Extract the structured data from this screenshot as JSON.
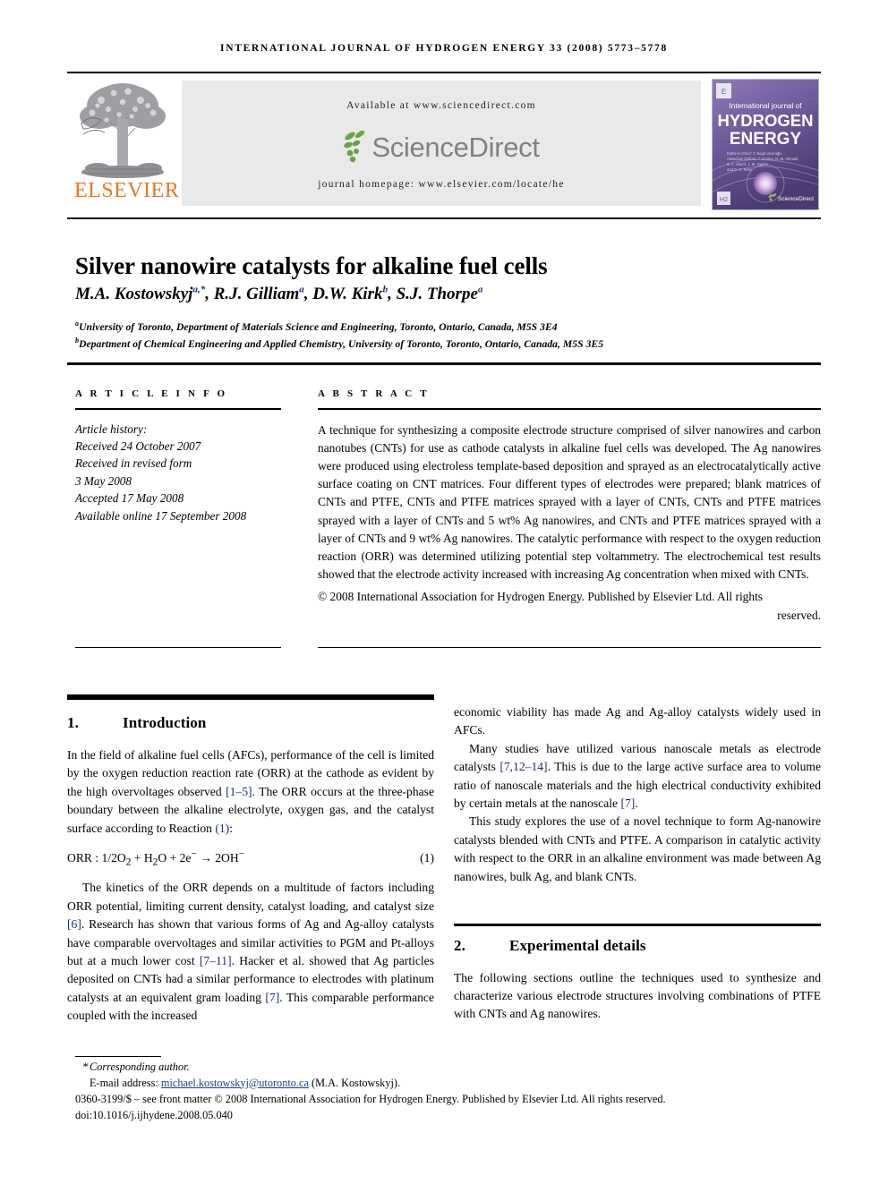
{
  "running_head": "INTERNATIONAL JOURNAL OF HYDROGEN ENERGY 33 (2008) 5773–5778",
  "header": {
    "publisher_name": "ELSEVIER",
    "available_at": "Available at www.sciencedirect.com",
    "sciencedirect_wordmark": "ScienceDirect",
    "journal_homepage": "journal homepage: www.elsevier.com/locate/he",
    "cover": {
      "line1": "International journal of",
      "line2": "HYDROGEN",
      "line3": "ENERGY",
      "sciencedirect_badge": "ScienceDirect"
    },
    "colors": {
      "elsevier_orange": "#E87722",
      "band_gray": "#e9e9e9",
      "sciencedirect_gray": "#808285",
      "sciencedirect_green": "#6aa442",
      "cover_purple": "#7b62a3"
    }
  },
  "article": {
    "title": "Silver nanowire catalysts for alkaline fuel cells",
    "authors_html": "M.A. Kostowskyj<sup>a,*</sup>, R.J. Gilliam<sup>a</sup>, D.W. Kirk<sup>b</sup>, S.J. Thorpe<sup>a</sup>",
    "affiliation_a": "University of Toronto, Department of Materials Science and Engineering, Toronto, Ontario, Canada, M5S 3E4",
    "affiliation_b": "Department of Chemical Engineering and Applied Chemistry, University of Toronto, Toronto, Ontario, Canada, M5S 3E5"
  },
  "article_info": {
    "heading": "A R T I C L E   I N F O",
    "history_label": "Article history:",
    "lines": [
      "Received 24 October 2007",
      "Received in revised form",
      "3 May 2008",
      "Accepted 17 May 2008",
      "Available online 17 September 2008"
    ]
  },
  "abstract": {
    "heading": "A B S T R A C T",
    "text": "A technique for synthesizing a composite electrode structure comprised of silver nanowires and carbon nanotubes (CNTs) for use as cathode catalysts in alkaline fuel cells was developed. The Ag nanowires were produced using electroless template-based deposition and sprayed as an electrocatalytically active surface coating on CNT matrices. Four different types of electrodes were prepared; blank matrices of CNTs and PTFE, CNTs and PTFE matrices sprayed with a layer of CNTs, CNTs and PTFE matrices sprayed with a layer of CNTs and 5 wt% Ag nanowires, and CNTs and PTFE matrices sprayed with a layer of CNTs and 9 wt% Ag nanowires. The catalytic performance with respect to the oxygen reduction reaction (ORR) was determined utilizing potential step voltammetry. The electrochemical test results showed that the electrode activity increased with increasing Ag concentration when mixed with CNTs.",
    "copyright": "© 2008 International Association for Hydrogen Energy. Published by Elsevier Ltd. All rights",
    "copyright_last": "reserved."
  },
  "sections": {
    "intro": {
      "number": "1.",
      "title": "Introduction",
      "p1_part1": "In the field of alkaline fuel cells (AFCs), performance of the cell is limited by the oxygen reduction reaction rate (ORR) at the cathode as evident by the high overvoltages observed ",
      "p1_ref1": "[1–5]",
      "p1_part2": ". The ORR occurs at the three-phase boundary between the alkaline electrolyte, oxygen gas, and the catalyst surface according to Reaction ",
      "p1_ref2": "(1)",
      "p1_part3": ":",
      "equation": "ORR : 1/2O2 + H2O + 2e− → 2OH−",
      "equation_number": "(1)",
      "p2_part1": "The kinetics of the ORR depends on a multitude of factors including ORR potential, limiting current density, catalyst loading, and catalyst size ",
      "p2_ref1": "[6]",
      "p2_part2": ". Research has shown that various forms of Ag and Ag-alloy catalysts have comparable overvoltages and similar activities to PGM and Pt-alloys but at a much lower cost ",
      "p2_ref2": "[7–11]",
      "p2_part3": ". Hacker et al. showed that Ag particles deposited on CNTs had a similar performance to electrodes with platinum catalysts at an equivalent gram loading ",
      "p2_ref3": "[7]",
      "p2_part4": ". This comparable performance coupled with the increased economic viability has made Ag and Ag-alloy catalysts widely used in AFCs.",
      "p3_part1": "Many studies have utilized various nanoscale metals as electrode catalysts ",
      "p3_ref1": "[7,12–14]",
      "p3_part2": ". This is due to the large active surface area to volume ratio of nanoscale materials and the high electrical conductivity exhibited by certain metals at the nanoscale ",
      "p3_ref2": "[7]",
      "p3_part3": ".",
      "p4": "This study explores the use of a novel technique to form Ag-nanowire catalysts blended with CNTs and PTFE. A comparison in catalytic activity with respect to the ORR in an alkaline environment was made between Ag nanowires, bulk Ag, and blank CNTs."
    },
    "experimental": {
      "number": "2.",
      "title": "Experimental details",
      "p1": "The following sections outline the techniques used to synthesize and characterize various electrode structures involving combinations of PTFE with CNTs and Ag nanowires."
    }
  },
  "footnote": {
    "star": "*",
    "corresponding": "Corresponding author.",
    "email_label": "E-mail address: ",
    "email": "michael.kostowskyj@utoronto.ca",
    "email_suffix": " (M.A. Kostowskyj).",
    "front_matter": "0360-3199/$ – see front matter © 2008 International Association for Hydrogen Energy. Published by Elsevier Ltd. All rights reserved.",
    "doi": "doi:10.1016/j.ijhydene.2008.05.040"
  }
}
